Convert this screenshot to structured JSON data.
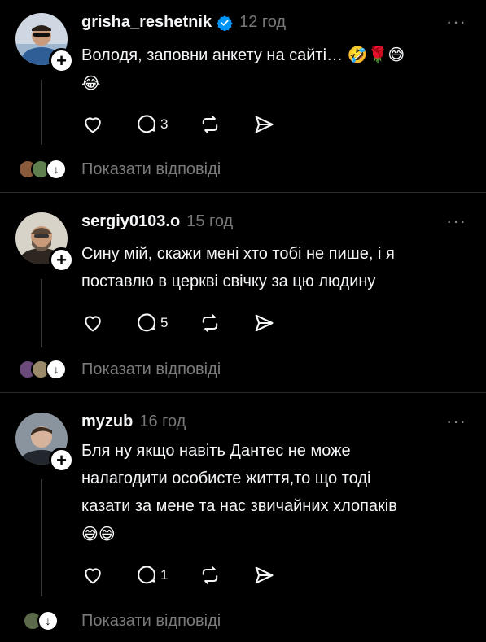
{
  "posts": [
    {
      "username": "grisha_reshetnik",
      "verified": true,
      "time": "12 год",
      "text": "Володя, заповни анкету на сайті…",
      "emoji_line1": "🤣🌹😅",
      "emoji_line2": "😂",
      "comments": "3",
      "replies_label": "Показати відповіді",
      "avatar_colors": [
        "#8aa0b8",
        "#3d6ea8"
      ]
    },
    {
      "username": "sergiy0103.o",
      "verified": false,
      "time": "15 год",
      "text_line1": "Сину мій, скажи мені хто тобі не пише, і я",
      "text_line2": "поставлю в церкві свічку за цю людину",
      "comments": "5",
      "replies_label": "Показати відповіді",
      "avatar_colors": [
        "#b9b5a8",
        "#4a3a2a"
      ]
    },
    {
      "username": "myzub",
      "verified": false,
      "time": "16 год",
      "text_line1": "Бля ну якщо навіть Дантес не може",
      "text_line2": "налагодити особисте життя,то що тоді",
      "text_line3": "казати за мене та нас звичайних хлопаків",
      "emoji_line": "😅😅",
      "comments": "1",
      "replies_label": "Показати відповіді",
      "avatar_colors": [
        "#7e8894",
        "#2a2f36"
      ]
    }
  ],
  "icons": {
    "like": "heart-icon",
    "comment": "comment-icon",
    "repost": "repost-icon",
    "share": "share-icon",
    "more": "more-icon",
    "verified": "verified-badge-icon",
    "follow": "plus-icon"
  },
  "accent_verified": "#0095f6"
}
